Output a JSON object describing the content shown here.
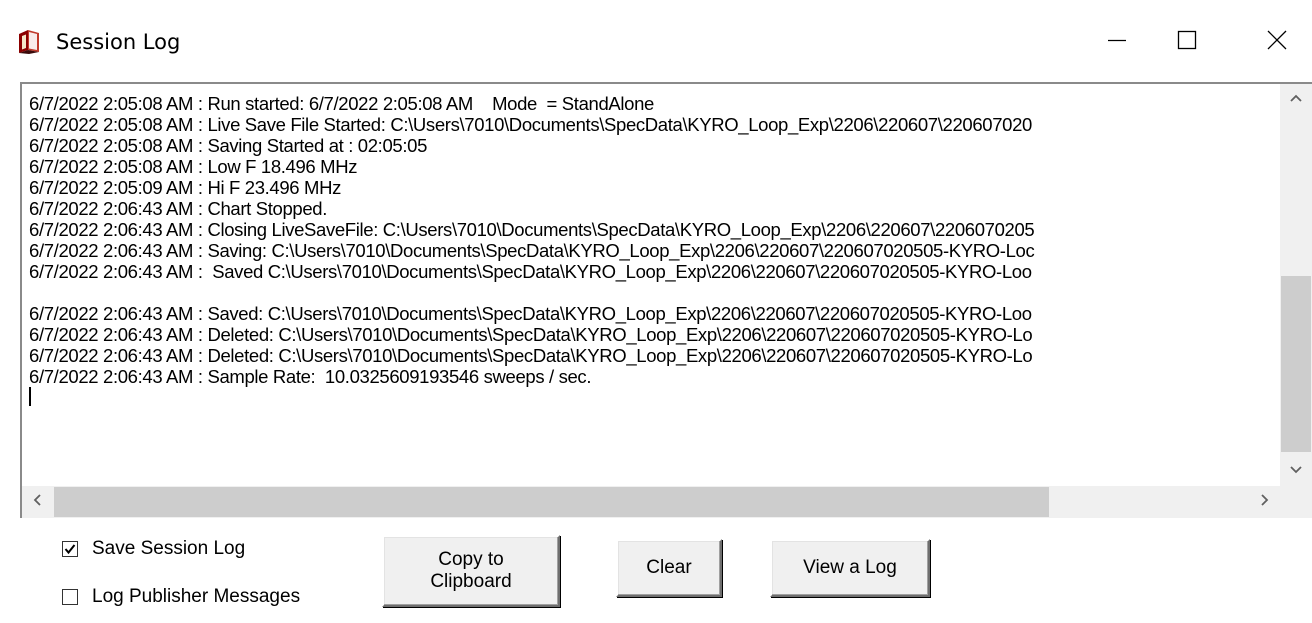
{
  "window": {
    "title": "Session Log",
    "icon": "book-icon",
    "controls": {
      "minimize": "minimize-icon",
      "maximize": "maximize-icon",
      "close": "close-icon"
    }
  },
  "log": {
    "lines": [
      "6/7/2022 2:05:08 AM : Run started: 6/7/2022 2:05:08 AM    Mode  = StandAlone",
      "6/7/2022 2:05:08 AM : Live Save File Started: C:\\Users\\7010\\Documents\\SpecData\\KYRO_Loop_Exp\\2206\\220607\\220607020",
      "6/7/2022 2:05:08 AM : Saving Started at : 02:05:05",
      "6/7/2022 2:05:08 AM : Low F 18.496 MHz",
      "6/7/2022 2:05:09 AM : Hi F 23.496 MHz",
      "6/7/2022 2:06:43 AM : Chart Stopped.",
      "6/7/2022 2:06:43 AM : Closing LiveSaveFile: C:\\Users\\7010\\Documents\\SpecData\\KYRO_Loop_Exp\\2206\\220607\\2206070205",
      "6/7/2022 2:06:43 AM : Saving: C:\\Users\\7010\\Documents\\SpecData\\KYRO_Loop_Exp\\2206\\220607\\220607020505-KYRO-Loc",
      "6/7/2022 2:06:43 AM :  Saved C:\\Users\\7010\\Documents\\SpecData\\KYRO_Loop_Exp\\2206\\220607\\220607020505-KYRO-Loo",
      "",
      "6/7/2022 2:06:43 AM : Saved: C:\\Users\\7010\\Documents\\SpecData\\KYRO_Loop_Exp\\2206\\220607\\220607020505-KYRO-Loo",
      "6/7/2022 2:06:43 AM : Deleted: C:\\Users\\7010\\Documents\\SpecData\\KYRO_Loop_Exp\\2206\\220607\\220607020505-KYRO-Lo",
      "6/7/2022 2:06:43 AM : Deleted: C:\\Users\\7010\\Documents\\SpecData\\KYRO_Loop_Exp\\2206\\220607\\220607020505-KYRO-Lo",
      "6/7/2022 2:06:43 AM : Sample Rate:  10.0325609193546 sweeps / sec."
    ]
  },
  "scrollbars": {
    "vertical": {
      "up": "chevron-up-icon",
      "down": "chevron-down-icon"
    },
    "horizontal": {
      "left": "chevron-left-icon",
      "right": "chevron-right-icon"
    }
  },
  "options": {
    "save_session_log": {
      "label": "Save Session Log",
      "checked": true
    },
    "log_publisher_messages": {
      "label": "Log Publisher Messages",
      "checked": false
    }
  },
  "buttons": {
    "copy_to_clipboard": "Copy to\nClipboard",
    "clear": "Clear",
    "view_a_log": "View a Log"
  },
  "colors": {
    "window_bg": "#ffffff",
    "button_face": "#f0f0f0",
    "scroll_thumb": "#cdcdcd",
    "border": "#8a8a8a"
  }
}
